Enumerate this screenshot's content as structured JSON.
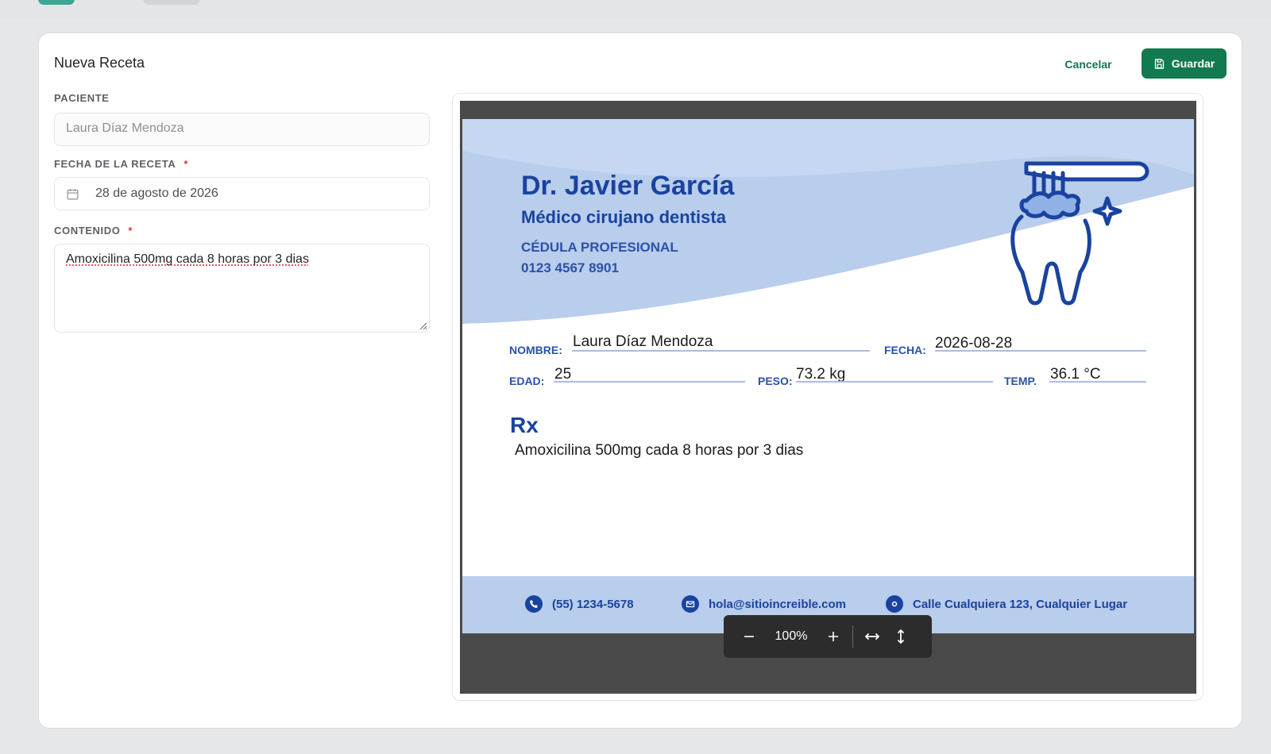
{
  "header": {
    "title": "Nueva Receta",
    "cancel_label": "Cancelar",
    "save_label": "Guardar"
  },
  "form": {
    "patient_label": "PACIENTE",
    "patient_value": "Laura Díaz Mendoza",
    "date_label": "FECHA DE LA RECETA",
    "date_value": "28 de agosto de 2026",
    "content_label": "CONTENIDO",
    "content_value": "Amoxicilina 500mg cada 8 horas por 3 dias",
    "required_mark": "*"
  },
  "prescription": {
    "doctor_name": "Dr. Javier García",
    "doctor_title": "Médico cirujano dentista",
    "cedula_label": "CÉDULA PROFESIONAL",
    "cedula_number": "0123 4567 8901",
    "nombre_label": "NOMBRE:",
    "nombre_value": "Laura Díaz Mendoza",
    "fecha_label": "FECHA:",
    "fecha_value": "2026-08-28",
    "edad_label": "EDAD:",
    "edad_value": "25",
    "peso_label": "PESO:",
    "peso_value": "73.2 kg",
    "temp_label": "TEMP.",
    "temp_value": "36.1 °C",
    "rx_label": "Rx",
    "rx_content": "Amoxicilina 500mg cada 8 horas por 3 dias",
    "phone": "(55) 1234-5678",
    "email": "hola@sitioincreible.com",
    "address": "Calle Cualquiera 123, Cualquier Lugar"
  },
  "viewer": {
    "zoom": "100%",
    "zoom_out_icon": "minus-icon",
    "zoom_in_icon": "plus-icon",
    "fit_width_icon": "fit-width-icon",
    "fit_height_icon": "fit-height-icon"
  },
  "colors": {
    "primary": "#13794f",
    "doc_blue": "#1a43a0",
    "required": "#d83a3a"
  }
}
